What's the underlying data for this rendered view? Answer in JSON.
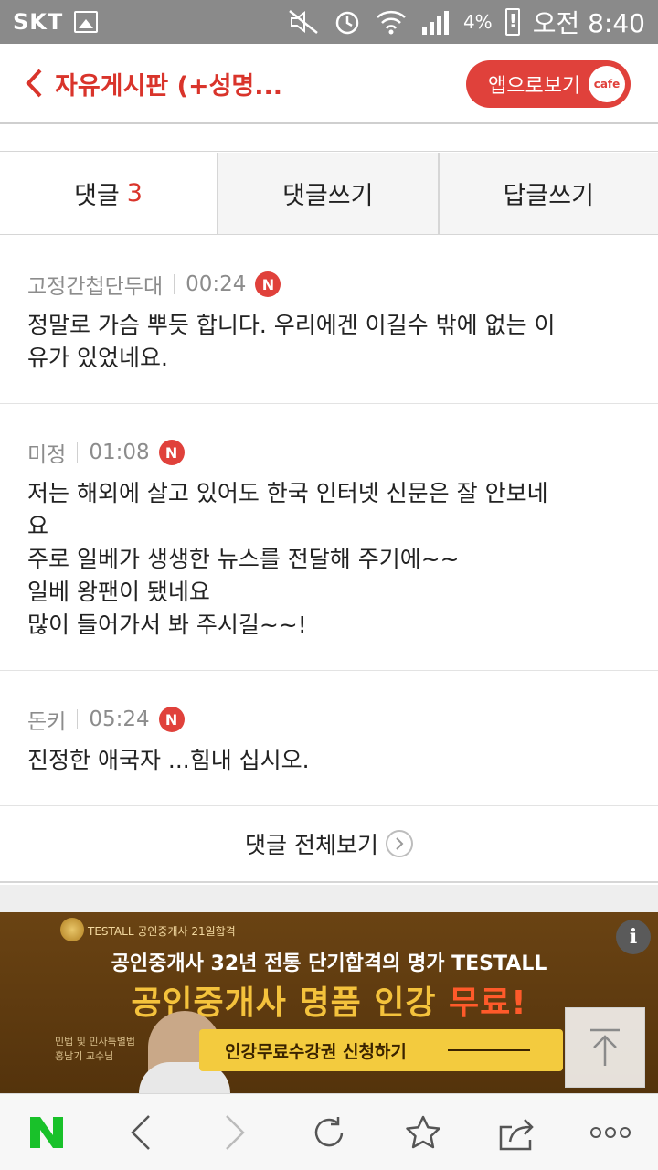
{
  "status_bar": {
    "carrier": "SKT",
    "battery": "4%",
    "time": "오전 8:40"
  },
  "header": {
    "title": "자유게시판 (+성명...",
    "app_button_label": "앱으로보기",
    "app_button_badge": "cafe"
  },
  "tabs": [
    {
      "label": "댓글",
      "count": "3"
    },
    {
      "label": "댓글쓰기"
    },
    {
      "label": "답글쓰기"
    }
  ],
  "comments": [
    {
      "author": "고정간첩단두대",
      "time": "00:24",
      "badge": "N",
      "text": "정말로 가슴 뿌듯 합니다. 우리에겐 이길수 밖에 없는 이\n유가 있었네요."
    },
    {
      "author": "미정",
      "time": "01:08",
      "badge": "N",
      "text": "저는 해외에 살고 있어도 한국 인터넷 신문은 잘 안보네\n요\n주로 일베가 생생한 뉴스를 전달해 주기에~~\n일베 왕팬이 됐네요\n많이 들어가서 봐 주시길~~!"
    },
    {
      "author": "돈키",
      "time": "05:24",
      "badge": "N",
      "text": "진정한 애국자 ...힘내 십시오."
    }
  ],
  "view_all_label": "댓글 전체보기",
  "ad": {
    "brand": "TESTALL 공인중개사 21일합격",
    "headline": "공인중개사 32년 전통 단기합격의 명가 TESTALL",
    "main_prefix": "공인중개사 명품 인강",
    "main_free": "무료!",
    "cta": "인강무료수강권 신청하기",
    "subject": "민법 및 민사특별법\n홍남기 교수님",
    "info": "i"
  },
  "colors": {
    "accent": "#d9342b",
    "naver_green": "#19c12a"
  }
}
